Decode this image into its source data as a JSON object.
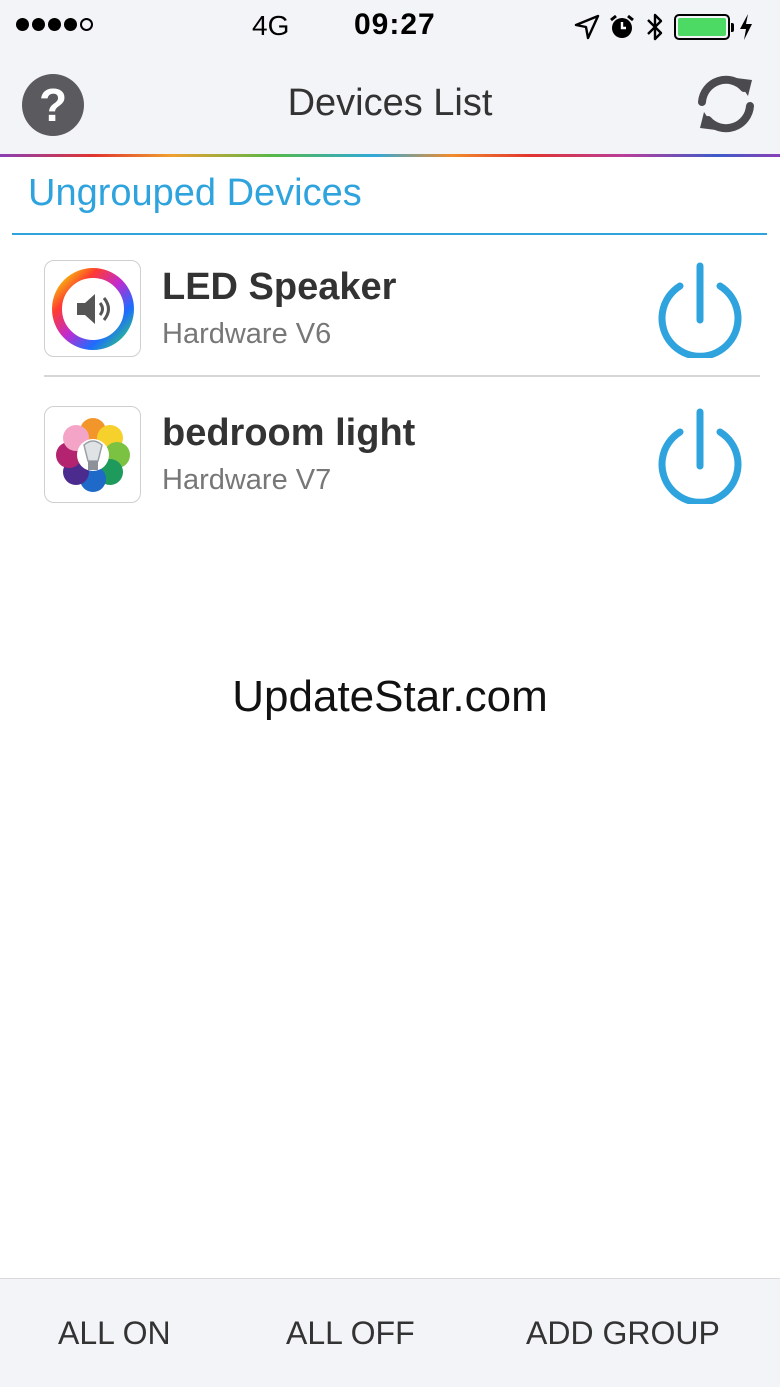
{
  "status_bar": {
    "signal_filled": 4,
    "signal_total": 5,
    "network": "4G",
    "time": "09:27",
    "battery_level": 1.0,
    "icons": [
      "location-arrow-icon",
      "alarm-icon",
      "bluetooth-icon",
      "battery-icon",
      "charging-bolt-icon"
    ]
  },
  "nav": {
    "title": "Devices List",
    "left_icon": "help-icon",
    "right_icon": "refresh-icon"
  },
  "section": {
    "title": "Ungrouped Devices"
  },
  "devices": [
    {
      "name": "LED Speaker",
      "hardware": "Hardware V6",
      "icon": "speaker-color-wheel-icon",
      "power_icon": "power-icon"
    },
    {
      "name": "bedroom light",
      "hardware": "Hardware V7",
      "icon": "bulb-color-flower-icon",
      "power_icon": "power-icon"
    }
  ],
  "watermark": "UpdateStar.com",
  "bottom_bar": {
    "all_on": "ALL ON",
    "all_off": "ALL OFF",
    "add_group": "ADD GROUP"
  },
  "colors": {
    "accent": "#2ea3dd",
    "bar_background": "#f3f4f8",
    "battery_green": "#4cd964",
    "help_button": "#5a5a5f"
  }
}
